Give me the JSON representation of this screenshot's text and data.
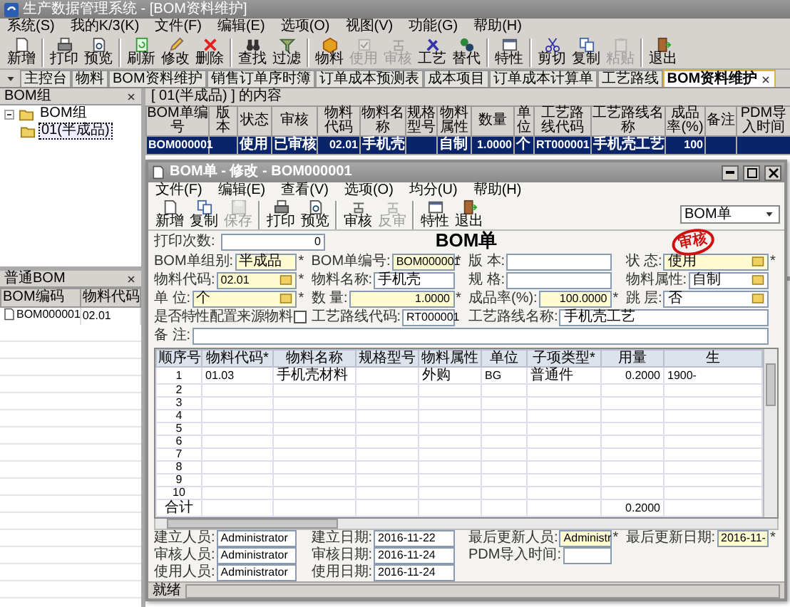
{
  "window": {
    "title": "生产数据管理系统 - [BOM资料维护]"
  },
  "menu": [
    "系统(S)",
    "我的K/3(K)",
    "文件(F)",
    "编辑(E)",
    "选项(O)",
    "视图(V)",
    "功能(G)",
    "帮助(H)"
  ],
  "toolbar": [
    [
      {
        "label": "新增",
        "disabled": false
      }
    ],
    [
      {
        "label": "打印",
        "disabled": false
      },
      {
        "label": "预览",
        "disabled": false
      }
    ],
    [
      {
        "label": "刷新",
        "disabled": false
      },
      {
        "label": "修改",
        "disabled": false
      },
      {
        "label": "删除",
        "disabled": false
      }
    ],
    [
      {
        "label": "查找",
        "disabled": false
      },
      {
        "label": "过滤",
        "disabled": false
      }
    ],
    [
      {
        "label": "物料",
        "disabled": false
      },
      {
        "label": "使用",
        "disabled": true
      },
      {
        "label": "审核",
        "disabled": true
      },
      {
        "label": "工艺",
        "disabled": false
      },
      {
        "label": "替代",
        "disabled": false
      }
    ],
    [
      {
        "label": "特性",
        "disabled": false
      }
    ],
    [
      {
        "label": "剪切",
        "disabled": false
      },
      {
        "label": "复制",
        "disabled": false
      },
      {
        "label": "粘贴",
        "disabled": true
      }
    ],
    [
      {
        "label": "退出",
        "disabled": false
      }
    ]
  ],
  "tabs": [
    {
      "label": "主控台",
      "selected": false,
      "closable": false
    },
    {
      "label": "物料",
      "selected": false,
      "closable": false
    },
    {
      "label": "BOM资料维护",
      "selected": false,
      "closable": false
    },
    {
      "label": "销售订单序时簿",
      "selected": false,
      "closable": false
    },
    {
      "label": "订单成本预测表",
      "selected": false,
      "closable": false
    },
    {
      "label": "成本项目",
      "selected": false,
      "closable": false
    },
    {
      "label": "订单成本计算单",
      "selected": false,
      "closable": false
    },
    {
      "label": "工艺路线",
      "selected": false,
      "closable": false
    },
    {
      "label": "BOM资料维护",
      "selected": true,
      "closable": true
    }
  ],
  "tree_panel": {
    "title": "BOM组",
    "tree": [
      {
        "label": "BOM组",
        "expanded": true,
        "selected": false,
        "children": [
          {
            "label": "01(半成品)",
            "selected": true
          }
        ]
      }
    ]
  },
  "list_panel": {
    "title": "普通BOM",
    "columns": [
      "BOM编码",
      "物料代码"
    ],
    "rows": [
      [
        "BOM000001",
        "02.01"
      ]
    ]
  },
  "content": {
    "heading": "[ 01(半成品) ] 的内容",
    "columns": [
      "BOM单编号",
      "版本",
      "状态",
      "审核",
      "物料代码",
      "物料名称",
      "规格型号",
      "物料属性",
      "数量",
      "单位",
      "工艺路线代码",
      "工艺路线名称",
      "成品率(%)",
      "备注",
      "PDM导入时间"
    ],
    "rows": [
      {
        "selected": true,
        "cells": [
          "BOM000001",
          null,
          "使用",
          "已审核",
          "02.01",
          "手机壳",
          null,
          "自制",
          "1.0000",
          "个",
          "RT000001",
          "手机壳工艺",
          "100",
          null,
          null
        ]
      }
    ]
  },
  "dialog": {
    "title": "BOM单 - 修改 - BOM000001",
    "menu": [
      "文件(F)",
      "编辑(E)",
      "查看(V)",
      "选项(O)",
      "均分(U)",
      "帮助(H)"
    ],
    "toolbar": [
      [
        {
          "label": "新增",
          "disabled": false
        },
        {
          "label": "复制",
          "disabled": false
        },
        {
          "label": "保存",
          "disabled": true
        }
      ],
      [
        {
          "label": "打印",
          "disabled": false
        },
        {
          "label": "预览",
          "disabled": false
        }
      ],
      [
        {
          "label": "审核",
          "disabled": false
        },
        {
          "label": "反审",
          "disabled": true
        }
      ],
      [
        {
          "label": "特性",
          "disabled": false
        },
        {
          "label": "退出",
          "disabled": false
        }
      ]
    ],
    "view_select": "BOM单",
    "print_count_label": "打印次数:",
    "print_count": "0",
    "heading": "BOM单",
    "stamp": "审核",
    "form": [
      [
        {
          "kind": "text",
          "label": "BOM单组别:",
          "value": "半成品",
          "marker": "*"
        },
        {
          "kind": "text",
          "label": "BOM单编号:",
          "value": "BOM000001",
          "marker": "*"
        },
        {
          "kind": "text",
          "label": "版 本:"
        },
        {
          "kind": "lookup",
          "label": "状 态:",
          "value": "使用",
          "marker": "*"
        }
      ],
      [
        {
          "kind": "lookup",
          "label": "物料代码:",
          "value": "02.01",
          "marker": "*"
        },
        {
          "kind": "text",
          "label": "物料名称:",
          "value": "手机壳"
        },
        {
          "kind": "text",
          "label": "规 格:"
        },
        {
          "kind": "lookup",
          "label": "物料属性:",
          "value": "自制"
        }
      ],
      [
        {
          "kind": "lookup",
          "label": "单 位:",
          "value": "个",
          "marker": "*"
        },
        {
          "kind": "number",
          "label": "数 量:",
          "value": "1.0000",
          "marker": "*"
        },
        {
          "kind": "number",
          "label": "成品率(%):",
          "value": "100.0000",
          "marker": "*"
        },
        {
          "kind": "lookup",
          "label": "跳 层:",
          "value": "否"
        }
      ],
      [
        {
          "kind": "check",
          "label": "是否特性配置来源物料",
          "checked": false
        },
        {
          "kind": "text",
          "label": "工艺路线代码:",
          "value": "RT000001"
        },
        {
          "kind": "text",
          "label": "工艺路线名称:",
          "value": "手机壳工艺"
        }
      ],
      [
        {
          "kind": "wide",
          "label": "备 注:"
        }
      ]
    ],
    "grid": {
      "columns": [
        "顺序号",
        "物料代码*",
        "物料名称",
        "规格型号",
        "物料属性",
        "单位",
        "子项类型*",
        "用量",
        "生"
      ],
      "rows": [
        [
          "1",
          "01.03",
          "手机壳材料",
          null,
          "外购",
          "BG",
          "普通件",
          "0.2000",
          "1900-"
        ],
        [
          "2"
        ],
        [
          "3"
        ],
        [
          "4"
        ],
        [
          "5"
        ],
        [
          "6"
        ],
        [
          "7"
        ],
        [
          "8"
        ],
        [
          "9"
        ],
        [
          "10"
        ]
      ],
      "total": {
        "label": "合计",
        "amount": "0.2000"
      }
    },
    "footer": [
      [
        {
          "label": "建立人员:",
          "value": "Administrator"
        },
        {
          "label": "建立日期:",
          "value": "2016-11-22"
        },
        {
          "label": "最后更新人员:",
          "value": "Administr",
          "marker": "*"
        },
        {
          "label": "最后更新日期:",
          "value": "2016-11-",
          "marker": "*"
        }
      ],
      [
        {
          "label": "审核人员:",
          "value": "Administrator"
        },
        {
          "label": "审核日期:",
          "value": "2016-11-24"
        },
        {
          "label": "PDM导入时间:"
        }
      ],
      [
        {
          "label": "使用人员:",
          "value": "Administrator"
        },
        {
          "label": "使用日期:",
          "value": "2016-11-24"
        }
      ]
    ],
    "status": "就绪"
  }
}
